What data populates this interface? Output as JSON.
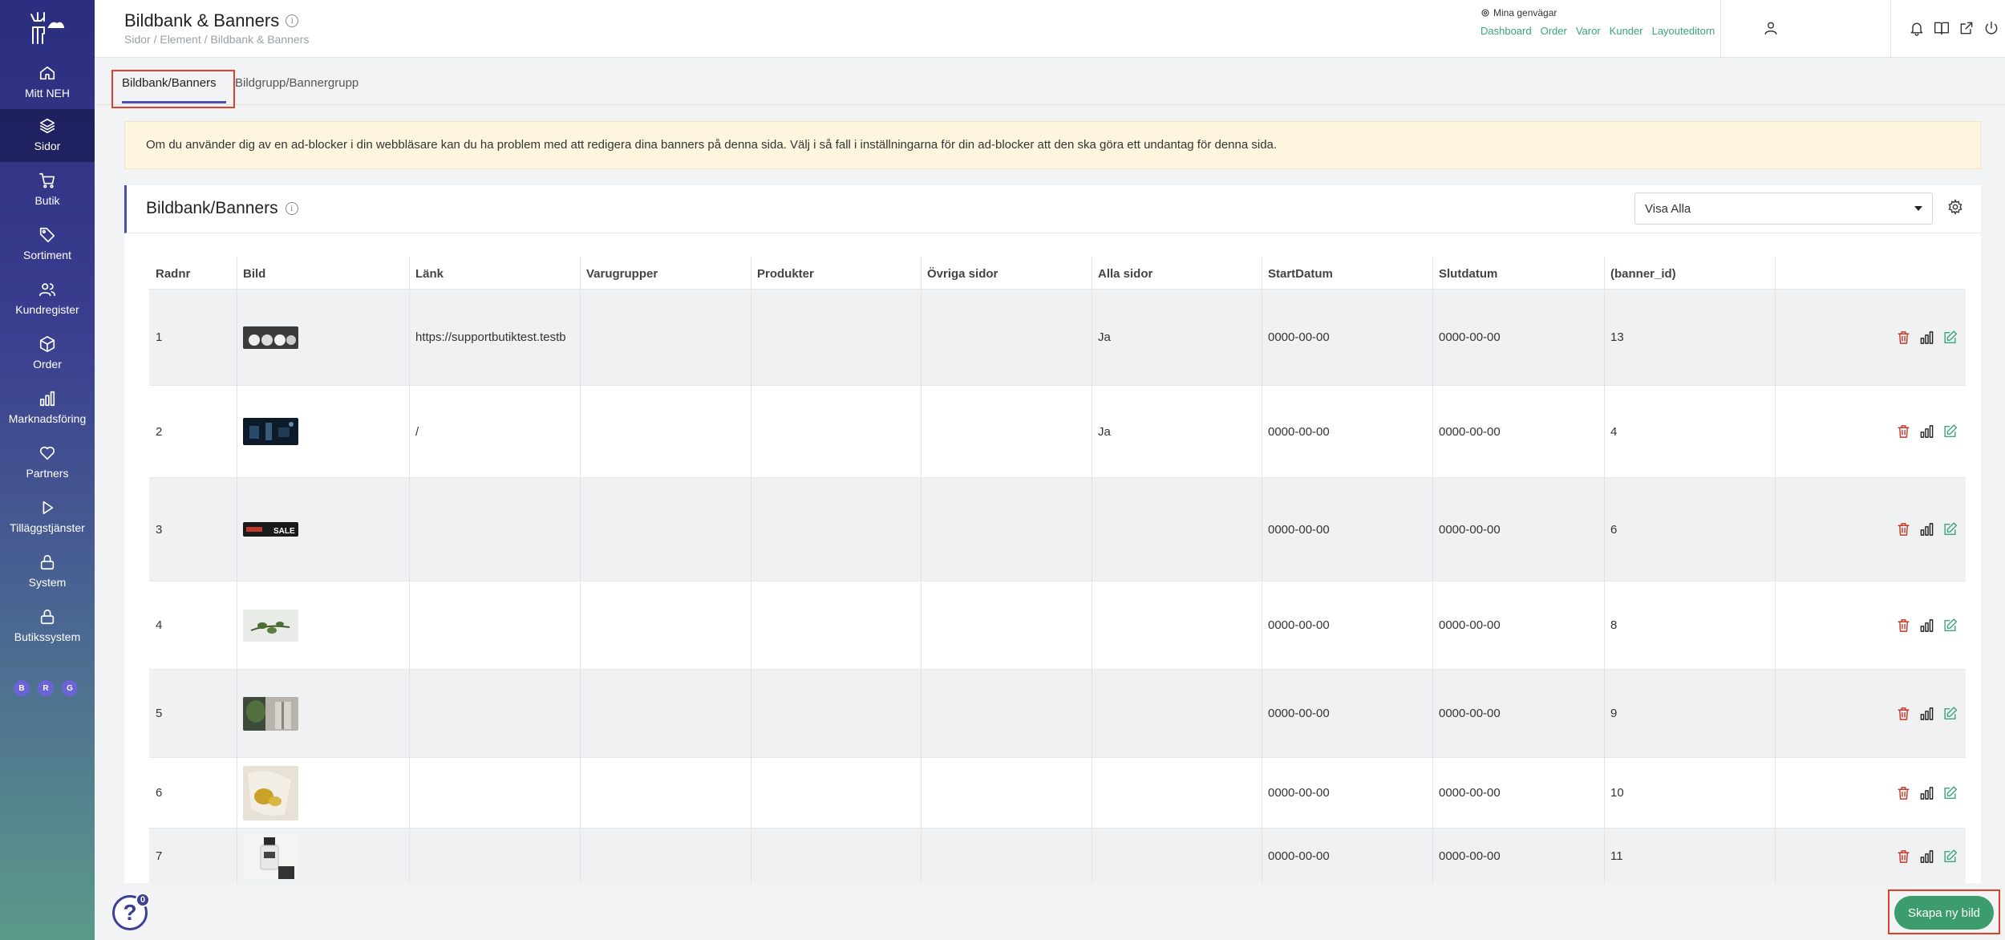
{
  "sidebar": {
    "items": [
      {
        "label": "Mitt NEH",
        "icon": "home-icon"
      },
      {
        "label": "Sidor",
        "icon": "layers-icon"
      },
      {
        "label": "Butik",
        "icon": "cart-icon"
      },
      {
        "label": "Sortiment",
        "icon": "tag-icon"
      },
      {
        "label": "Kundregister",
        "icon": "users-icon"
      },
      {
        "label": "Order",
        "icon": "box-icon"
      },
      {
        "label": "Marknadsföring",
        "icon": "bar-chart-icon"
      },
      {
        "label": "Partners",
        "icon": "heart-icon"
      },
      {
        "label": "Tilläggstjänster",
        "icon": "play-icon"
      },
      {
        "label": "System",
        "icon": "lock-icon"
      },
      {
        "label": "Butikssystem",
        "icon": "lock-icon"
      }
    ],
    "badges": [
      "B",
      "R",
      "G"
    ]
  },
  "header": {
    "title": "Bildbank & Banners",
    "breadcrumb": "Sidor / Element / Bildbank & Banners",
    "shortcuts_title": "Mina genvägar",
    "shortcuts": [
      "Dashboard",
      "Order",
      "Varor",
      "Kunder",
      "Layouteditorn"
    ]
  },
  "tabs": [
    "Bildbank/Banners",
    "Bildgrupp/Bannergrupp"
  ],
  "alert": "Om du använder dig av en ad-blocker i din webbläsare kan du ha problem med att redigera dina banners på denna sida. Välj i så fall i inställningarna för din ad-blocker att den ska göra ett undantag för denna sida.",
  "card": {
    "title": "Bildbank/Banners",
    "filter_value": "Visa Alla"
  },
  "table": {
    "headers": [
      "Radnr",
      "Bild",
      "Länk",
      "Varugrupper",
      "Produkter",
      "Övriga sidor",
      "Alla sidor",
      "StartDatum",
      "Slutdatum",
      "(banner_id)"
    ],
    "rows": [
      {
        "nr": "1",
        "link": "https://supportbutiktest.testb",
        "alla": "Ja",
        "start": "0000-00-00",
        "slut": "0000-00-00",
        "id": "13",
        "thumb": "white-products"
      },
      {
        "nr": "2",
        "link": "/",
        "alla": "Ja",
        "start": "0000-00-00",
        "slut": "0000-00-00",
        "id": "4",
        "thumb": "dark-banner"
      },
      {
        "nr": "3",
        "link": "",
        "alla": "",
        "start": "0000-00-00",
        "slut": "0000-00-00",
        "id": "6",
        "thumb": "sale-banner"
      },
      {
        "nr": "4",
        "link": "",
        "alla": "",
        "start": "0000-00-00",
        "slut": "0000-00-00",
        "id": "8",
        "thumb": "plant-branch"
      },
      {
        "nr": "5",
        "link": "",
        "alla": "",
        "start": "0000-00-00",
        "slut": "0000-00-00",
        "id": "9",
        "thumb": "plants-room"
      },
      {
        "nr": "6",
        "link": "",
        "alla": "",
        "start": "0000-00-00",
        "slut": "0000-00-00",
        "id": "10",
        "thumb": "yellow-cloth"
      },
      {
        "nr": "7",
        "link": "",
        "alla": "",
        "start": "0000-00-00",
        "slut": "0000-00-00",
        "id": "11",
        "thumb": "bottle-white"
      }
    ]
  },
  "footer": {
    "help_count": "0",
    "help_symbol": "?",
    "create_label": "Skapa ny bild"
  },
  "colors": {
    "accent": "#4a4fb5",
    "link_green": "#3aa57a",
    "button_green": "#3d9c6d",
    "delete_red": "#c0392b",
    "alert_bg": "#fdf5de",
    "highlight_red": "#e0402b"
  }
}
